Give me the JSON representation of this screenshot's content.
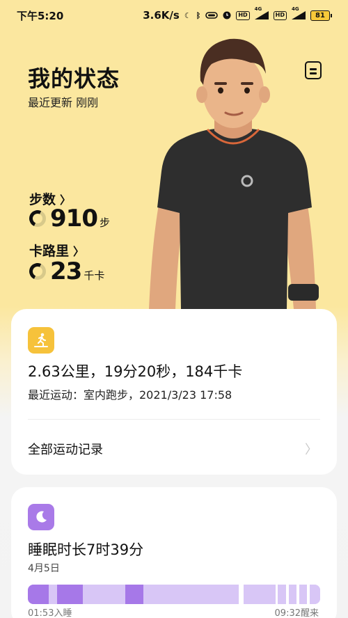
{
  "status_bar": {
    "time": "下午5:20",
    "network_speed": "3.6K/s",
    "icons": [
      "moon-icon",
      "bluetooth-icon",
      "nfc-icon",
      "alarm-icon",
      "hd-icon",
      "signal-icon",
      "hd-icon",
      "signal-icon"
    ],
    "hd_label": "HD",
    "net_label_1": "4G",
    "net_label_2": "4G",
    "battery": "81"
  },
  "header": {
    "title": "我的状态",
    "update_text": "最近更新 刚刚",
    "doc_icon": "document-icon"
  },
  "steps": {
    "label": "步数",
    "value": "910",
    "unit": "步"
  },
  "calories": {
    "label": "卡路里",
    "value": "23",
    "unit": "千卡"
  },
  "exercise_card": {
    "icon": "treadmill-icon",
    "summary": "2.63公里，19分20秒，184千卡",
    "recent": "最近运动：室内跑步，2021/3/23  17:58",
    "all_records": "全部运动记录",
    "colors": {
      "icon_bg": "#f6c23b"
    }
  },
  "sleep_card": {
    "icon": "moon-icon",
    "title": "睡眠时长7时39分",
    "date": "4月5日",
    "start": "01:53入睡",
    "end": "09:32醒来",
    "segments": [
      {
        "type": "deep",
        "weight": 8
      },
      {
        "type": "light",
        "weight": 3
      },
      {
        "type": "deep",
        "weight": 10
      },
      {
        "type": "light",
        "weight": 16
      },
      {
        "type": "deep",
        "weight": 7
      },
      {
        "type": "light",
        "weight": 36
      },
      {
        "type": "gap",
        "weight": 2
      },
      {
        "type": "light",
        "weight": 12
      },
      {
        "type": "gap",
        "weight": 1
      },
      {
        "type": "light",
        "weight": 3
      },
      {
        "type": "gap",
        "weight": 1
      },
      {
        "type": "light",
        "weight": 3
      },
      {
        "type": "gap",
        "weight": 1
      },
      {
        "type": "light",
        "weight": 3
      },
      {
        "type": "gap",
        "weight": 1
      },
      {
        "type": "light",
        "weight": 4
      }
    ],
    "colors": {
      "icon_bg": "#a97ae8",
      "deep": "#a678e8",
      "light": "#d8c6f6",
      "gap": "#ffffff"
    }
  }
}
